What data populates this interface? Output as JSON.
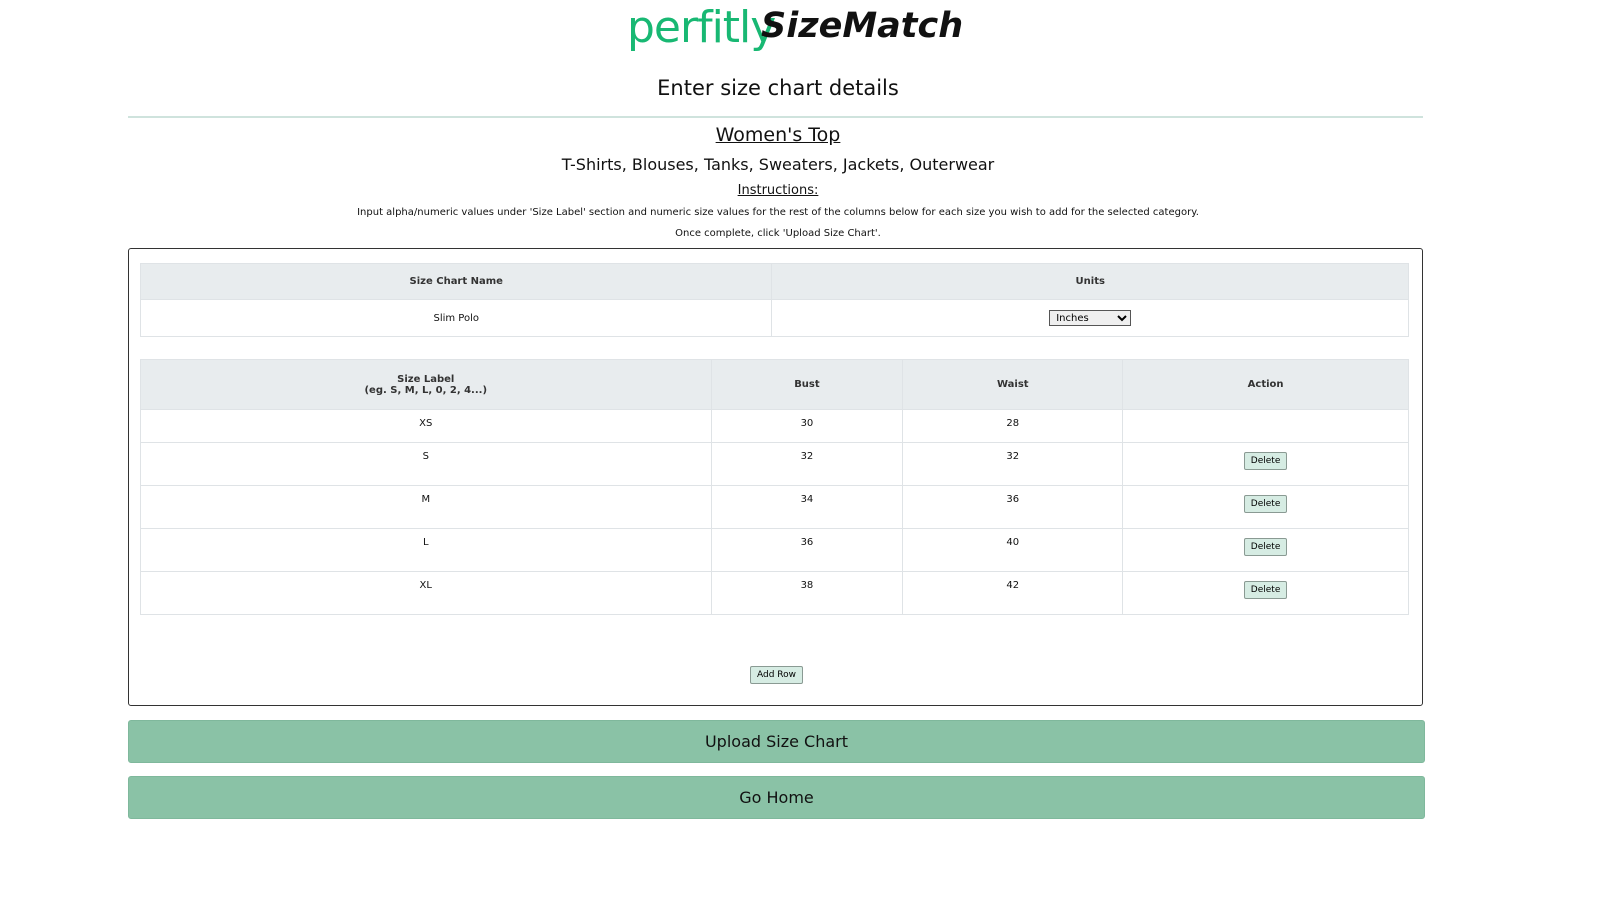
{
  "brand": {
    "name_part1": "perfitly",
    "name_part2": "SizeMatch"
  },
  "page": {
    "heading": "Enter size chart details"
  },
  "category": {
    "title": "Women's Top",
    "subtitle": "T-Shirts, Blouses, Tanks, Sweaters, Jackets, Outerwear"
  },
  "instructions": {
    "title": "Instructions:",
    "line1": "Input alpha/numeric values under 'Size Label' section and numeric size values for the rest of the columns below for each size you wish to add for the selected category.",
    "line2": "Once complete, click 'Upload Size Chart'."
  },
  "chart_info": {
    "headers": {
      "name": "Size Chart Name",
      "units": "Units"
    },
    "name_value": "Slim Polo",
    "units_value": "Inches"
  },
  "size_table": {
    "headers": {
      "size_label_line1": "Size Label",
      "size_label_line2": "(eg. S, M, L, 0, 2, 4...)",
      "bust": "Bust",
      "waist": "Waist",
      "action": "Action"
    },
    "rows": [
      {
        "label": "XS",
        "bust": "30",
        "waist": "28",
        "action": ""
      },
      {
        "label": "S",
        "bust": "32",
        "waist": "32",
        "action": "Delete"
      },
      {
        "label": "M",
        "bust": "34",
        "waist": "36",
        "action": "Delete"
      },
      {
        "label": "L",
        "bust": "36",
        "waist": "40",
        "action": "Delete"
      },
      {
        "label": "XL",
        "bust": "38",
        "waist": "42",
        "action": "Delete"
      }
    ]
  },
  "buttons": {
    "add_row": "Add Row",
    "upload": "Upload Size Chart",
    "home": "Go Home"
  },
  "colors": {
    "brand_green": "#18b873",
    "button_green": "#8ac2a6"
  }
}
